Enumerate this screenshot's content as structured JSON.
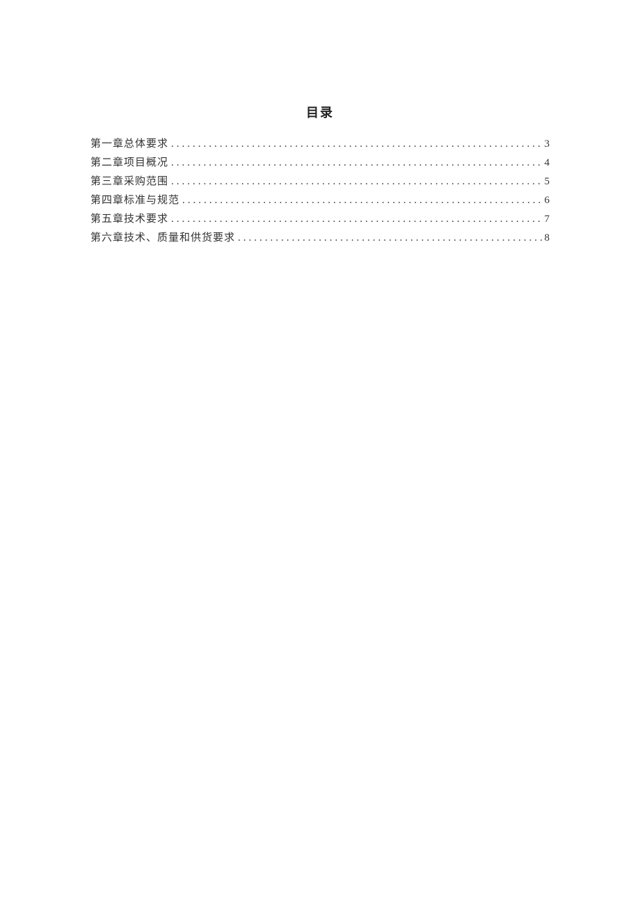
{
  "toc": {
    "title": "目录",
    "entries": [
      {
        "label": "第一章总体要求",
        "page": "3"
      },
      {
        "label": "第二章项目概况",
        "page": "4"
      },
      {
        "label": "第三章采购范围",
        "page": "5"
      },
      {
        "label": "第四章标准与规范",
        "page": "6"
      },
      {
        "label": "第五章技术要求",
        "page": "7"
      },
      {
        "label": "第六章技术、质量和供货要求",
        "page": "8"
      }
    ]
  }
}
